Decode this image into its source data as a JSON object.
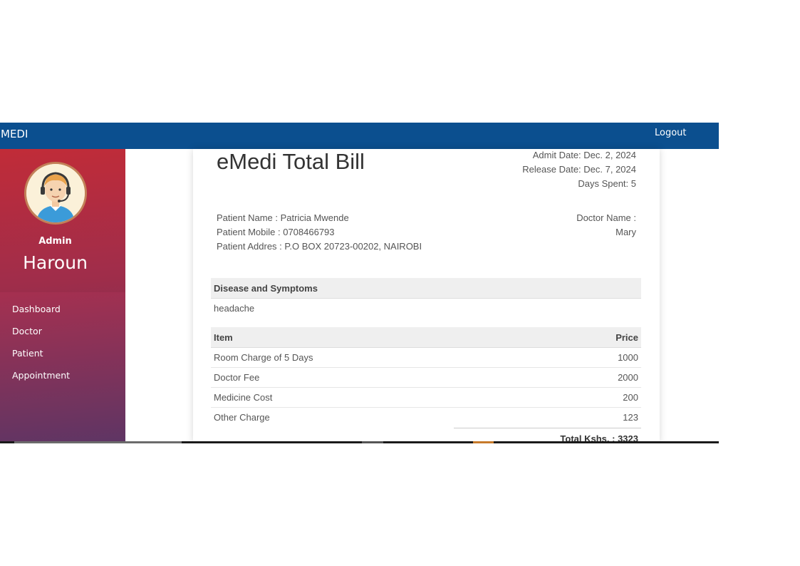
{
  "app": {
    "brand": "MEDI",
    "logout_label": "Logout",
    "accent": "#0b4f8f"
  },
  "sidebar": {
    "role": "Admin",
    "username": "Haroun",
    "items": [
      {
        "label": "Dashboard"
      },
      {
        "label": "Doctor"
      },
      {
        "label": "Patient"
      },
      {
        "label": "Appointment"
      }
    ]
  },
  "bill": {
    "title": "eMedi Total Bill",
    "admit_date": "Admit Date: Dec. 2, 2024",
    "release_date": "Release Date: Dec. 7, 2024",
    "days_spent": "Days Spent: 5",
    "patient_name": "Patient Name : Patricia Mwende",
    "patient_mobile": "Patient Mobile : 0708466793",
    "patient_address": "Patient Addres : P.O BOX 20723-00202, NAIROBI",
    "doctor_label": "Doctor Name :",
    "doctor_name": "Mary",
    "disease_header": "Disease and Symptoms",
    "disease_value": "headache",
    "item_header": "Item",
    "price_header": "Price",
    "items": [
      {
        "name": "Room Charge of 5 Days",
        "price": "1000"
      },
      {
        "name": "Doctor Fee",
        "price": "2000"
      },
      {
        "name": "Medicine Cost",
        "price": "200"
      },
      {
        "name": "Other Charge",
        "price": "123"
      }
    ],
    "total": "Total Kshs. : 3323"
  }
}
